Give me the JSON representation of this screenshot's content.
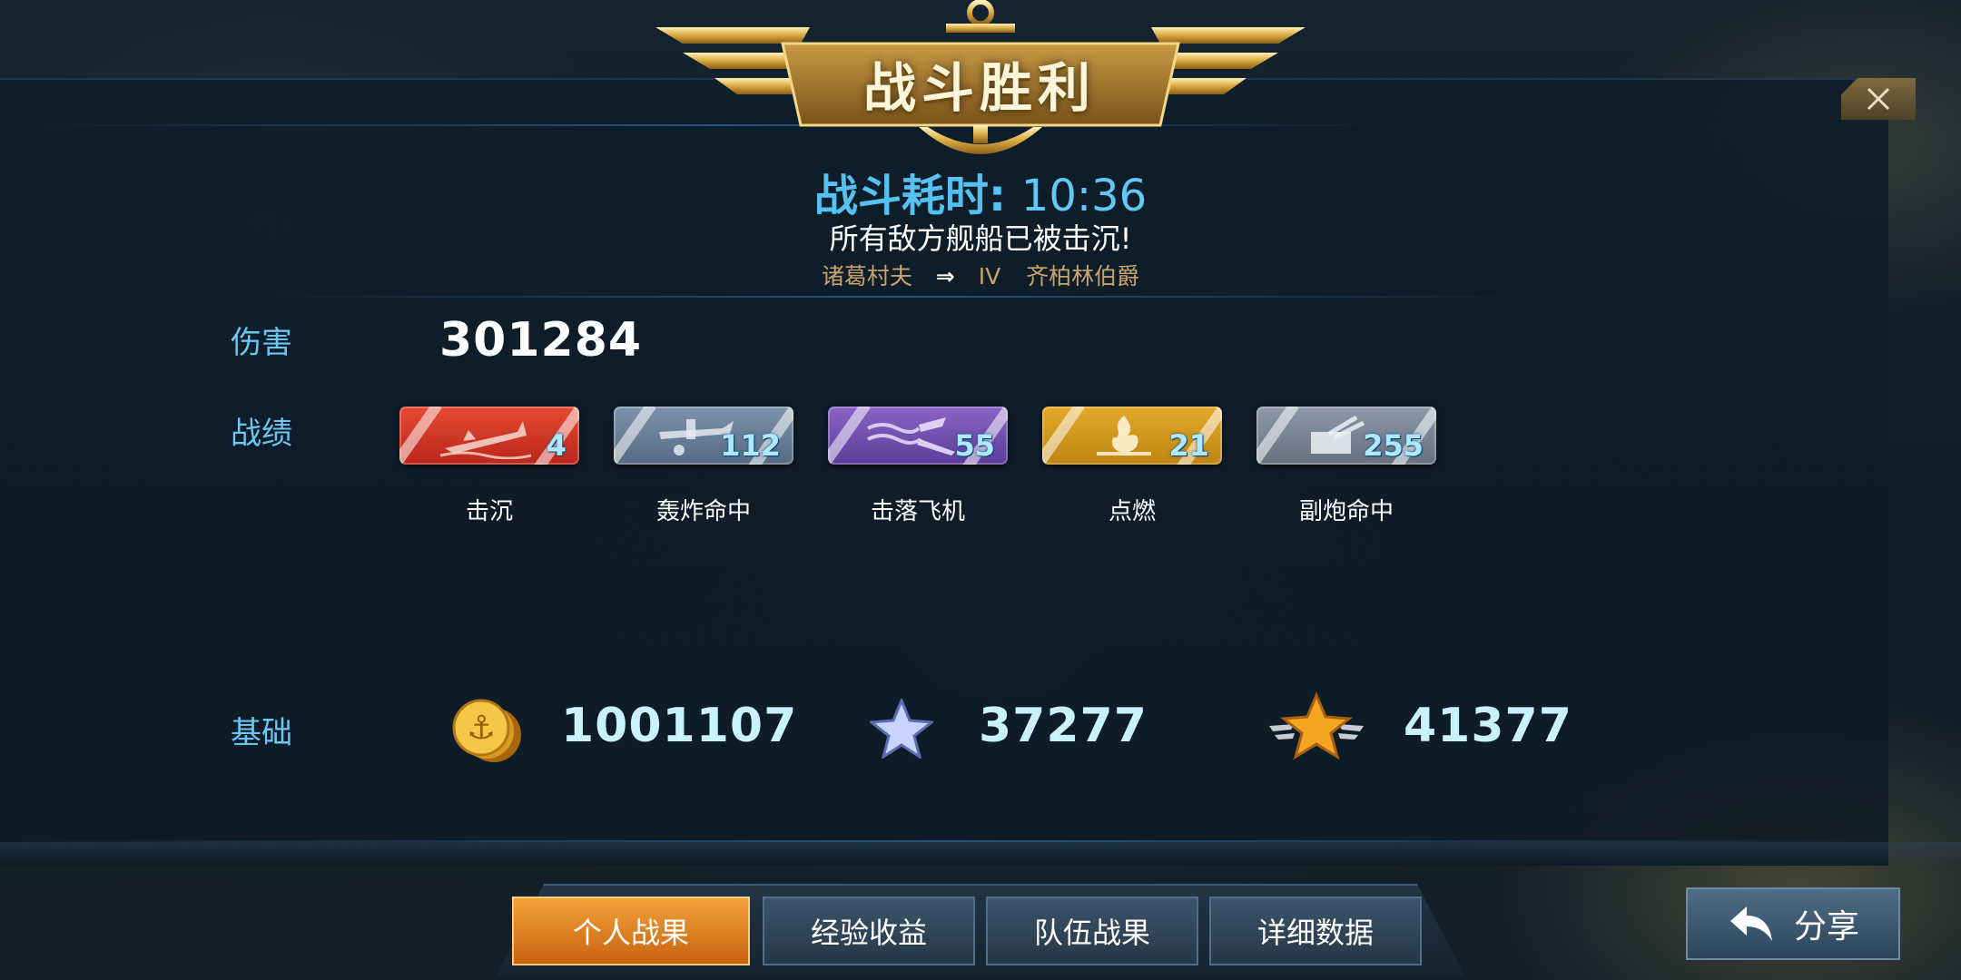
{
  "header": {
    "title": "战斗胜利",
    "battle_time_label": "战斗耗时:",
    "battle_time_value": "10:36",
    "result_message": "所有敌方舰船已被击沉!",
    "commander": "诸葛村夫",
    "ship_tier": "IV",
    "ship_name": "齐柏林伯爵"
  },
  "damage": {
    "label": "伤害",
    "value": "301284"
  },
  "achievements": {
    "label": "战绩",
    "items": [
      {
        "label": "击沉",
        "value": "4",
        "color": "#d7392a",
        "icon": "sinking-ship-icon"
      },
      {
        "label": "轰炸命中",
        "value": "112",
        "color": "#6a8098",
        "icon": "bomber-icon"
      },
      {
        "label": "击落飞机",
        "value": "55",
        "color": "#7550b0",
        "icon": "plane-shot-down-icon"
      },
      {
        "label": "点燃",
        "value": "21",
        "color": "#d4991f",
        "icon": "fire-icon"
      },
      {
        "label": "副炮命中",
        "value": "255",
        "color": "#7a8696",
        "icon": "secondary-gun-icon"
      }
    ]
  },
  "base": {
    "label": "基础",
    "credits": "1001107",
    "ship_xp": "37277",
    "commander_xp": "41377"
  },
  "tabs": [
    {
      "label": "个人战果",
      "active": true
    },
    {
      "label": "经验收益",
      "active": false
    },
    {
      "label": "队伍战果",
      "active": false
    },
    {
      "label": "详细数据",
      "active": false
    }
  ],
  "share": {
    "label": "分享"
  },
  "colors": {
    "accent_blue": "#54c1f0",
    "gold": "#e2aa2a",
    "active_tab": "#e8882a"
  }
}
